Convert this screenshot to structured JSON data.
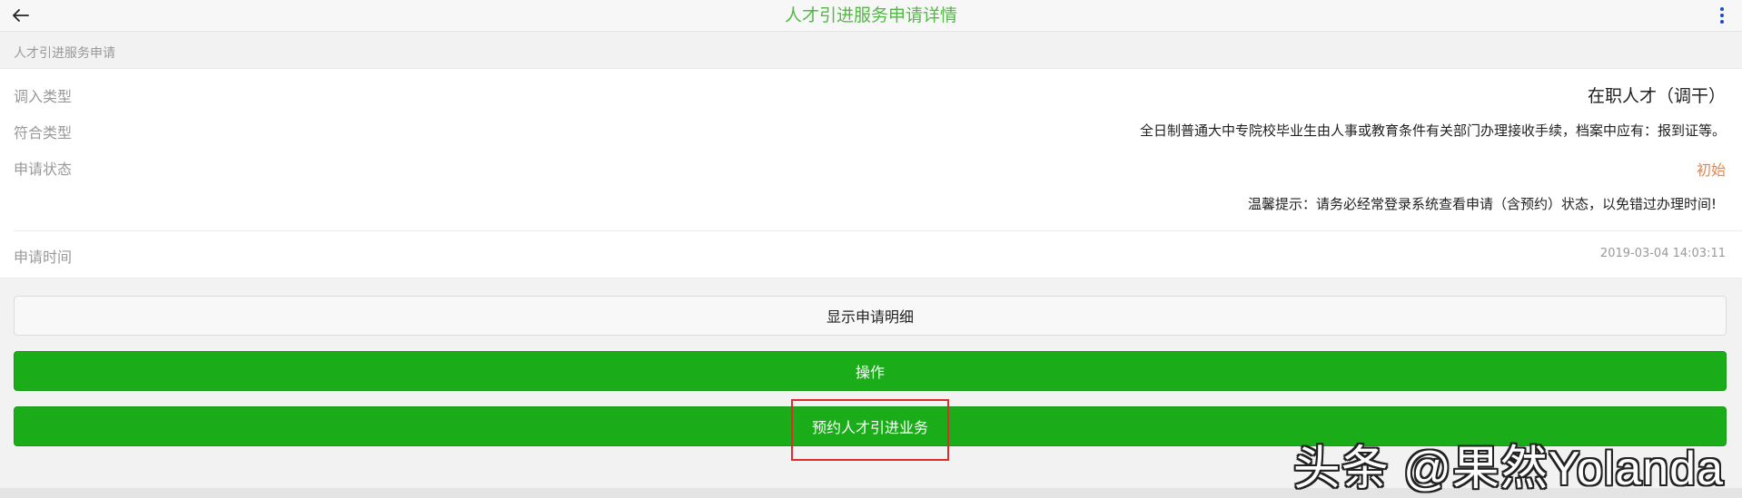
{
  "header": {
    "title": "人才引进服务申请详情",
    "back_icon": "arrow-left-icon",
    "menu_icon": "more-vertical-icon",
    "title_color": "#53b847"
  },
  "section": {
    "label": "人才引进服务申请"
  },
  "details": {
    "transfer_type_label": "调入类型",
    "transfer_type_value": "在职人才（调干）",
    "match_type_label": "符合类型",
    "match_type_value": "全日制普通大中专院校毕业生由人事或教育条件有关部门办理接收手续，档案中应有：报到证等。",
    "status_label": "申请状态",
    "status_value": "初始",
    "status_color": "#e8834a",
    "tip": "温馨提示：请务必经常登录系统查看申请（含预约）状态，以免错过办理时间!",
    "time_label": "申请时间",
    "time_value": "2019-03-04 14:03:11"
  },
  "actions": {
    "show_detail_label": "显示申请明细",
    "operate_label": "操作",
    "book_label": "预约人才引进业务",
    "primary_color": "#1aad19"
  },
  "watermark": "头条 @果然Yolanda"
}
